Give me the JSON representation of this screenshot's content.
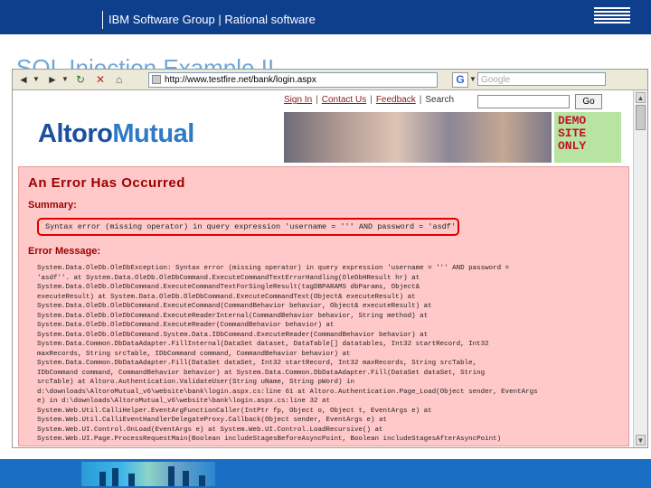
{
  "slide": {
    "header_text": "IBM Software Group | Rational software",
    "title": "SQL Injection Example II",
    "ibm_logo": "IBM"
  },
  "browser": {
    "back_icon": "back-arrow-icon",
    "forward_icon": "forward-arrow-icon",
    "url": "http://www.testfire.net/bank/login.aspx",
    "search_engine_icon": "G",
    "search_placeholder": "Google",
    "scrollbar_up": "▲",
    "scrollbar_down": "▼"
  },
  "site": {
    "nav": {
      "sign_in": "Sign In",
      "contact_us": "Contact Us",
      "feedback": "Feedback",
      "search_label": "Search",
      "separator": "|"
    },
    "go_label": "Go",
    "logo_part1": "Altoro",
    "logo_part2": "Mutual",
    "demo_lines": [
      "DEMO",
      "SITE",
      "ONLY"
    ]
  },
  "error": {
    "title": "An Error Has Occurred",
    "summary_heading": "Summary:",
    "summary_text": "Syntax error (missing operator) in query expression 'username = ''' AND password = 'asdf''.",
    "message_heading": "Error Message:",
    "stack_lines": [
      "System.Data.OleDb.OleDbException: Syntax error (missing operator) in query expression 'username = ''' AND password =",
      "'asdf''. at System.Data.OleDb.OleDbCommand.ExecuteCommandTextErrorHandling(OleDbHResult hr) at",
      "System.Data.OleDb.OleDbCommand.ExecuteCommandTextForSingleResult(tagDBPARAMS dbParams, Object&",
      "executeResult) at System.Data.OleDb.OleDbCommand.ExecuteCommandText(Object& executeResult) at",
      "System.Data.OleDb.OleDbCommand.ExecuteCommand(CommandBehavior behavior, Object& executeResult) at",
      "System.Data.OleDb.OleDbCommand.ExecuteReaderInternal(CommandBehavior behavior, String method) at",
      "System.Data.OleDb.OleDbCommand.ExecuteReader(CommandBehavior behavior) at",
      "System.Data.OleDb.OleDbCommand.System.Data.IDbCommand.ExecuteReader(CommandBehavior behavior) at",
      "System.Data.Common.DbDataAdapter.FillInternal(DataSet dataset, DataTable[] datatables, Int32 startRecord, Int32",
      "maxRecords, String srcTable, IDbCommand command, CommandBehavior behavior) at",
      "System.Data.Common.DbDataAdapter.Fill(DataSet dataSet, Int32 startRecord, Int32 maxRecords, String srcTable,",
      "IDbCommand command, CommandBehavior behavior) at System.Data.Common.DbDataAdapter.Fill(DataSet dataSet, String",
      "srcTable) at Altoro.Authentication.ValidateUser(String uName, String pWord) in",
      "d:\\downloads\\AltoroMutual_v6\\website\\bank\\login.aspx.cs:line 61 at Altoro.Authentication.Page_Load(Object sender, EventArgs",
      "e) in d:\\downloads\\AltoroMutual_v6\\website\\bank\\login.aspx.cs:line 32 at",
      "System.Web.Util.CalliHelper.EventArgFunctionCaller(IntPtr fp, Object o, Object t, EventArgs e) at",
      "System.Web.Util.CalliEventHandlerDelegateProxy.Callback(Object sender, EventArgs e) at",
      "System.Web.UI.Control.OnLoad(EventArgs e) at System.Web.UI.Control.LoadRecursive() at",
      "System.Web.UI.Page.ProcessRequestMain(Boolean includeStagesBeforeAsyncPoint, Boolean includeStagesAfterAsyncPoint)"
    ]
  },
  "colors": {
    "header_bg": "#0e3f8c",
    "title_color": "#6fa7d8",
    "error_panel_bg": "#ffc9c9",
    "error_text": "#9b0000",
    "highlight_border": "#e00000",
    "demo_bg": "#b7e4a1",
    "demo_text": "#c0102a"
  }
}
